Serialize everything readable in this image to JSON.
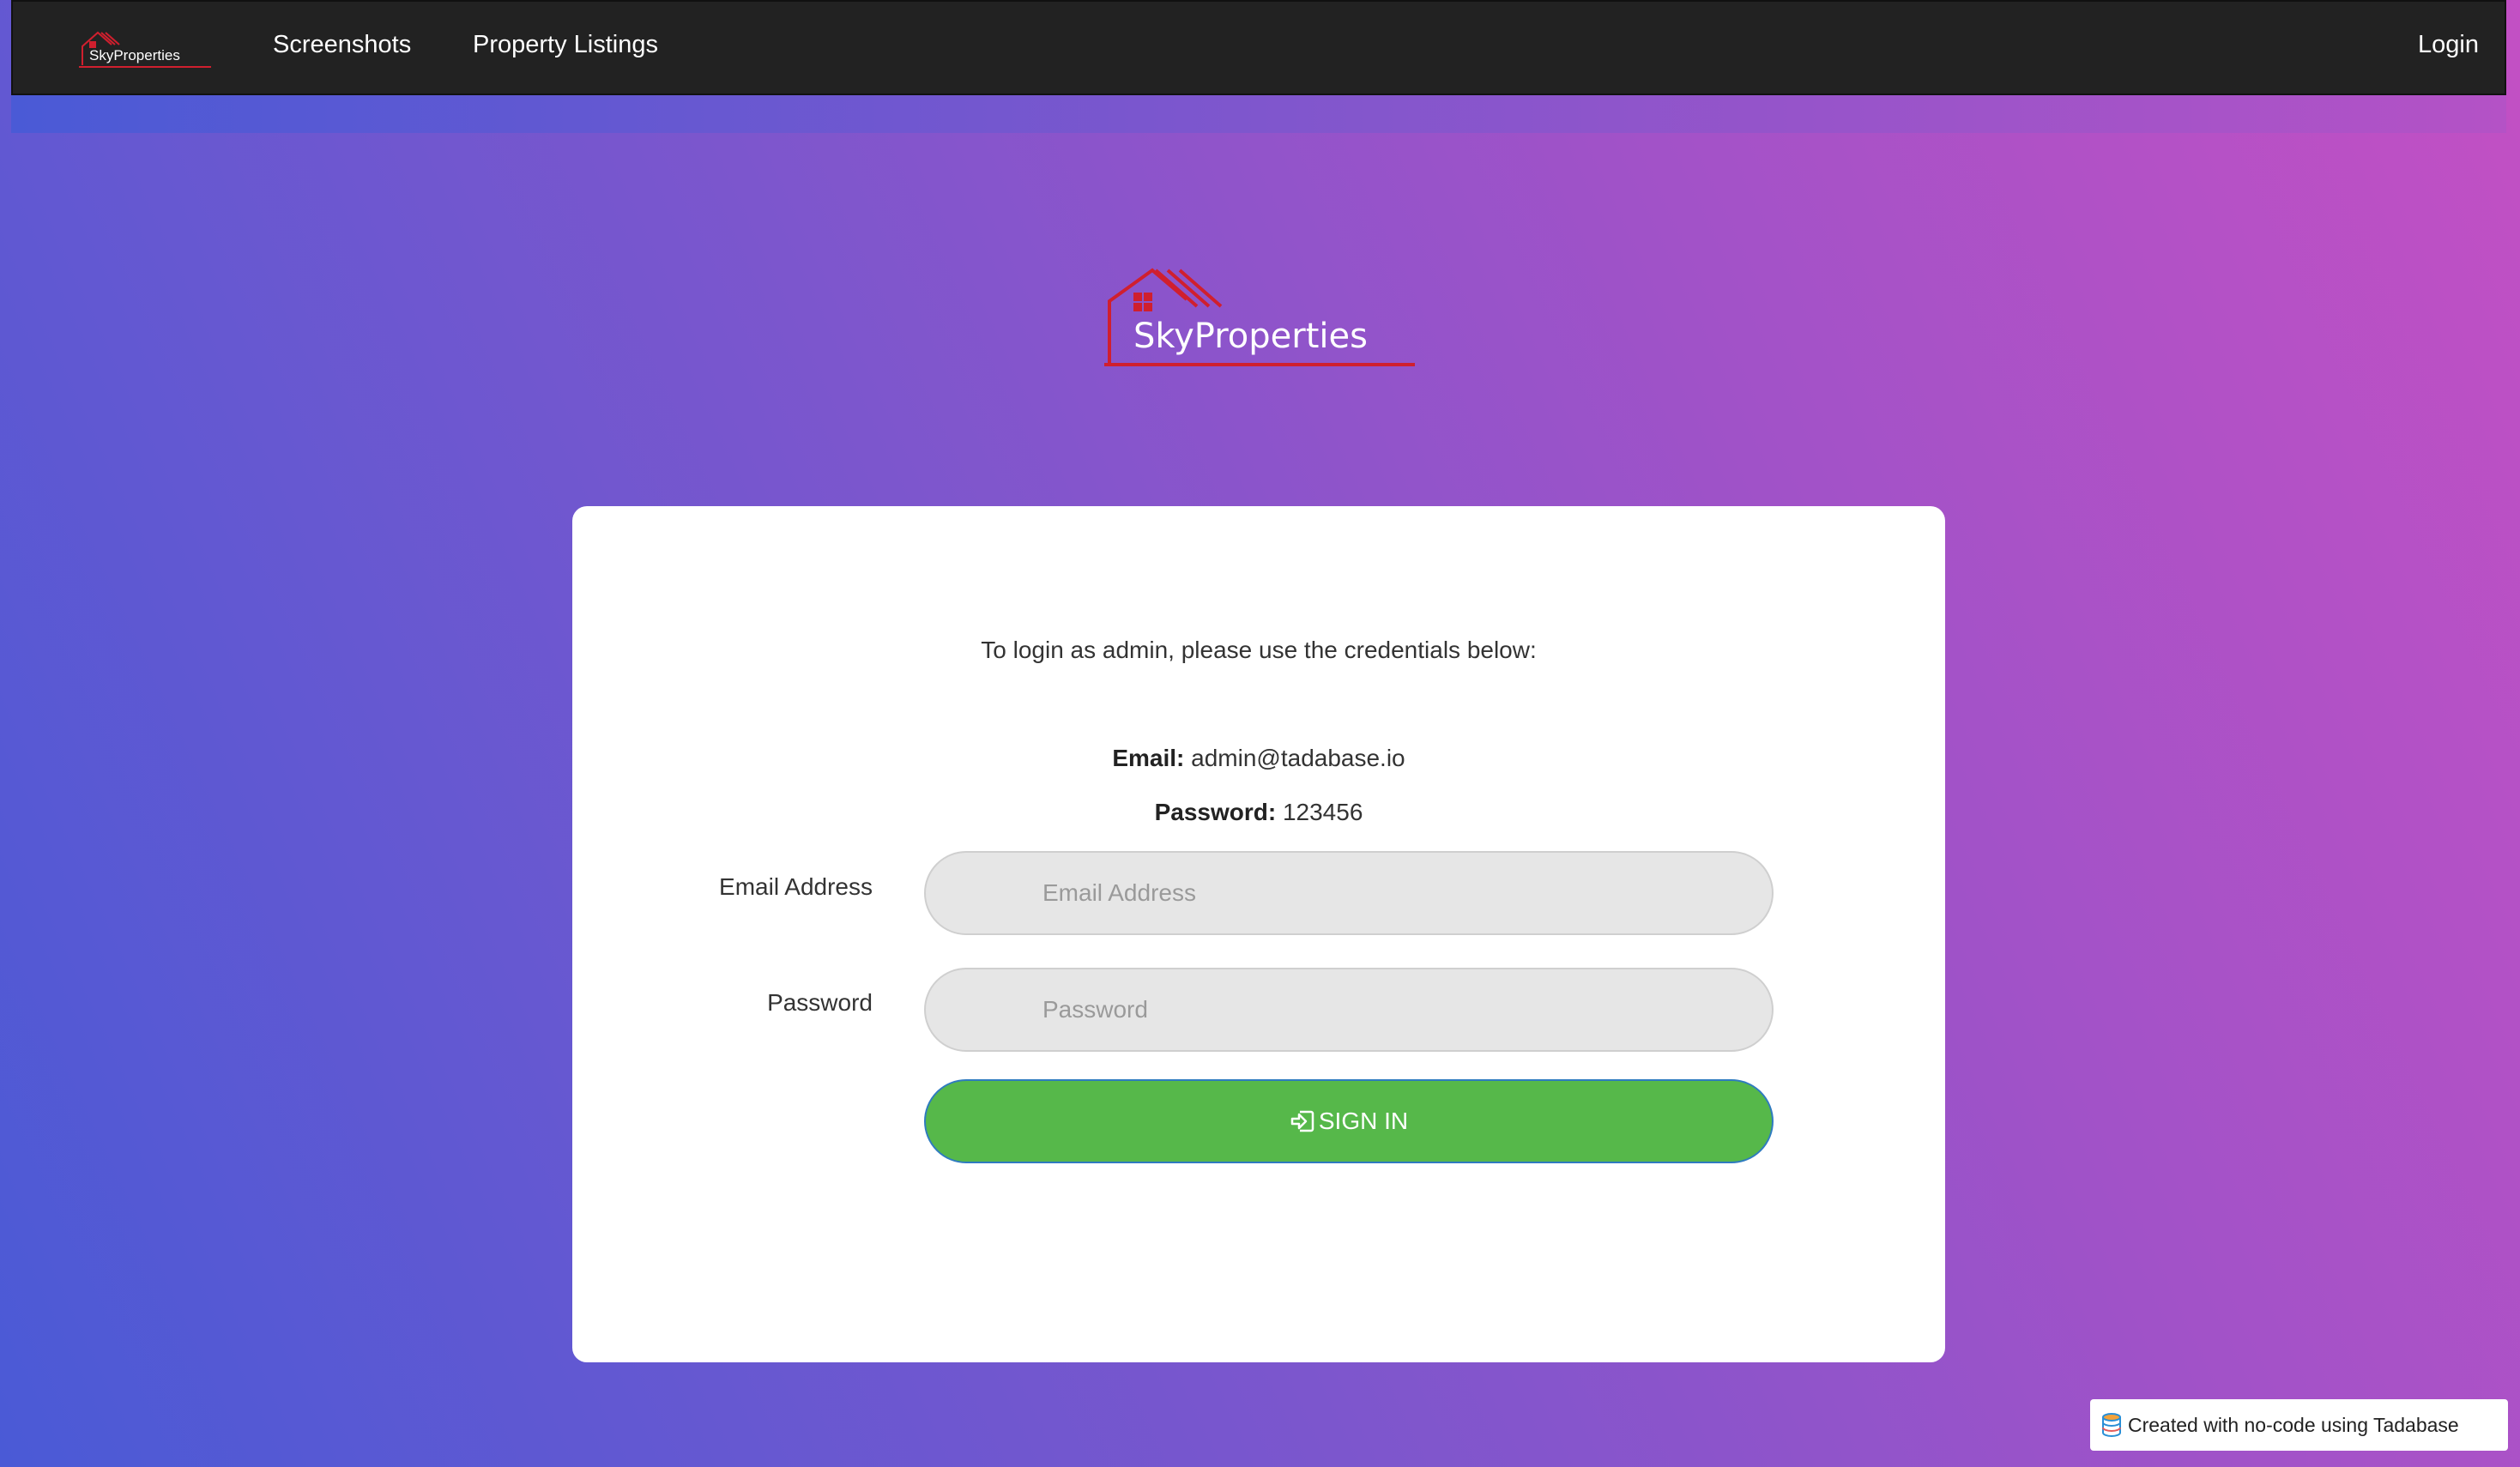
{
  "nav": {
    "logo_text": "SkyProperties",
    "links": [
      {
        "label": "Screenshots"
      },
      {
        "label": "Property Listings"
      }
    ],
    "login_label": "Login"
  },
  "hero": {
    "logo_text": "SkyProperties"
  },
  "card": {
    "intro": "To login as admin, please use the credentials below:",
    "email_key": "Email:",
    "email_value": "admin@tadabase.io",
    "password_key": "Password:",
    "password_value": "123456",
    "email_label": "Email Address",
    "email_placeholder": "Email Address",
    "password_label": "Password",
    "password_placeholder": "Password",
    "signin_label": "SIGN IN"
  },
  "footer_badge": "Created with no-code using Tadabase",
  "colors": {
    "navbar": "#222222",
    "signin": "#56b84a",
    "logo_red": "#d01f2e"
  }
}
